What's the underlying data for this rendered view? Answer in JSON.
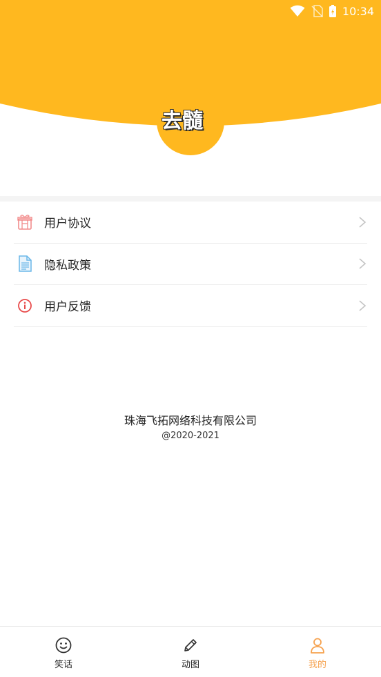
{
  "status_bar": {
    "time": "10:34"
  },
  "header": {
    "bg_color": "#FFB81F",
    "logo_text": "去髓"
  },
  "menu": {
    "items": [
      {
        "label": "用户协议",
        "icon": "gift-icon",
        "color": "#f28b8b"
      },
      {
        "label": "隐私政策",
        "icon": "document-icon",
        "color": "#6ab7e8"
      },
      {
        "label": "用户反馈",
        "icon": "info-icon",
        "color": "#e84a4a"
      }
    ]
  },
  "footer": {
    "company": "珠海飞拓网络科技有限公司",
    "copyright": "@2020-2021"
  },
  "bottom_nav": {
    "items": [
      {
        "label": "笑话",
        "icon": "smiley-icon",
        "active": false
      },
      {
        "label": "动图",
        "icon": "pencil-icon",
        "active": false
      },
      {
        "label": "我的",
        "icon": "person-icon",
        "active": true
      }
    ],
    "active_color": "#f6a24f"
  }
}
